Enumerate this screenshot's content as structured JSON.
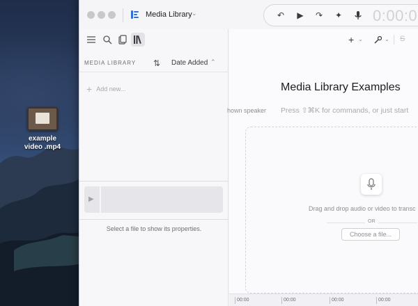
{
  "desktop": {
    "file_label": "example video .mp4"
  },
  "window": {
    "app_title": "Media Library",
    "timecode": "0:00:0"
  },
  "sidebar": {
    "section_title": "MEDIA LIBRARY",
    "sort_label": "Date Added",
    "add_new": "Add new...",
    "properties_message": "Select a file to show its properties."
  },
  "main": {
    "title": "Media Library Examples",
    "speaker_partial": "hown speaker",
    "command_hint": "Press ⇧⌘K for commands, or just start",
    "drop_text": "Drag and drop audio or video to transc",
    "or_text": "OR",
    "choose_button": "Choose a file...",
    "timeline_ticks": [
      "00:00",
      "00:00",
      "00:00",
      "00:00"
    ]
  },
  "colors": {
    "accent": "#2f6fd6",
    "window_bg": "#f7f6f9",
    "desktop_bg": "#23324f"
  }
}
